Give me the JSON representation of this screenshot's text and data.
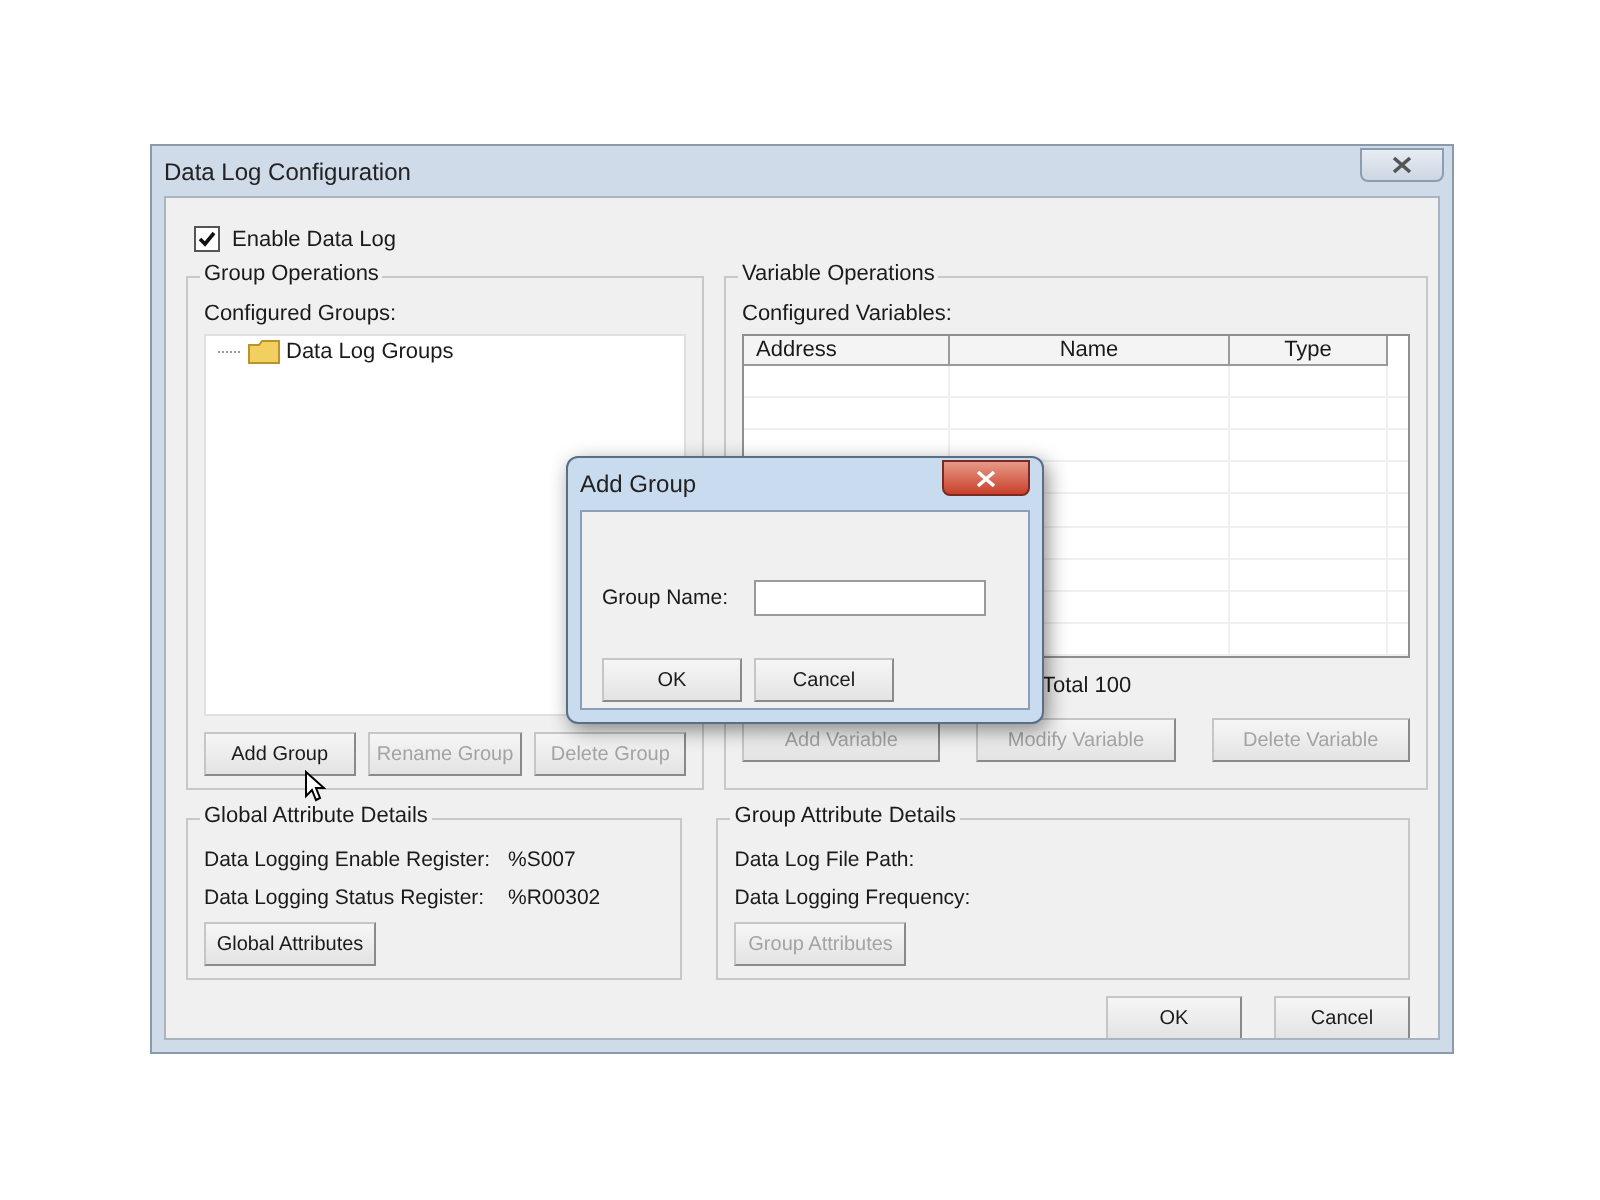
{
  "window": {
    "title": "Data Log Configuration"
  },
  "enable_data_log": {
    "label": "Enable Data Log",
    "checked": true
  },
  "group_operations": {
    "title": "Group Operations",
    "list_label": "Configured Groups:",
    "tree": [
      {
        "label": "Data Log Groups"
      }
    ],
    "buttons": [
      {
        "label": "Add Group",
        "disabled": false
      },
      {
        "label": "Rename Group",
        "disabled": true
      },
      {
        "label": "Delete Group",
        "disabled": true
      }
    ]
  },
  "variable_operations": {
    "title": "Variable Operations",
    "list_label": "Configured Variables:",
    "columns": [
      "Address",
      "Name",
      "Type"
    ],
    "summary": "Total 100",
    "buttons": [
      {
        "label": "Add Variable",
        "disabled": true
      },
      {
        "label": "Modify Variable",
        "disabled": true
      },
      {
        "label": "Delete Variable",
        "disabled": true
      }
    ]
  },
  "global_attribute_details": {
    "title": "Global Attribute Details",
    "fields": [
      {
        "label": "Data Logging Enable Register:",
        "value": "%S007"
      },
      {
        "label": "Data Logging Status Register:",
        "value": "%R00302"
      }
    ],
    "button": {
      "label": "Global Attributes",
      "disabled": false
    }
  },
  "group_attribute_details": {
    "title": "Group Attribute Details",
    "fields": [
      {
        "label": "Data Log File Path:"
      },
      {
        "label": "Data Logging Frequency:"
      }
    ],
    "button": {
      "label": "Group Attributes",
      "disabled": true
    }
  },
  "buttons": [
    {
      "label": "OK"
    },
    {
      "label": "Cancel"
    }
  ],
  "add_group_dialog": {
    "title": "Add Group",
    "field_label": "Group Name:",
    "buttons": [
      {
        "label": "OK"
      },
      {
        "label": "Cancel"
      }
    ]
  }
}
